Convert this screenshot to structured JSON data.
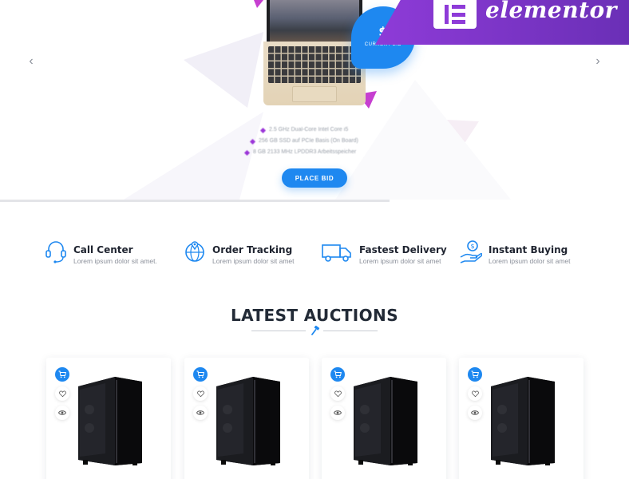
{
  "hero": {
    "price_text": "$",
    "price_label": "CURRENT BID",
    "specs": [
      "2.5 GHz Dual-Core Intel Core i5",
      "256 GB SSD auf PCIe Basis (On Board)",
      "8 GB 2133 MHz LPDDR3 Arbeitsspeicher"
    ],
    "bid_button": "PLACE BID",
    "brand_word": "elementor",
    "colors": {
      "accent": "#1e88f0",
      "purple": "#8e3bd8"
    }
  },
  "features": [
    {
      "title": "Call Center",
      "subtitle": "Lorem ipsum dolor sit amet.",
      "icon": "headset-icon"
    },
    {
      "title": "Order Tracking",
      "subtitle": "Lorem ipsum dolor sit amet",
      "icon": "globe-tracking-icon"
    },
    {
      "title": "Fastest Delivery",
      "subtitle": "Lorem ipsum dolor sit amet",
      "icon": "truck-icon"
    },
    {
      "title": "Instant Buying",
      "subtitle": "Lorem ipsum dolor sit amet",
      "icon": "hand-coin-icon"
    }
  ],
  "auctions": {
    "title": "LATEST AUCTIONS",
    "cards": [
      {
        "icons": [
          "cart-icon",
          "heart-icon",
          "eye-icon"
        ],
        "image": "pc-case"
      },
      {
        "icons": [
          "cart-icon",
          "heart-icon",
          "eye-icon"
        ],
        "image": "pc-case"
      },
      {
        "icons": [
          "cart-icon",
          "heart-icon",
          "eye-icon"
        ],
        "image": "pc-case"
      },
      {
        "icons": [
          "cart-icon",
          "heart-icon",
          "eye-icon"
        ],
        "image": "pc-case"
      }
    ]
  }
}
